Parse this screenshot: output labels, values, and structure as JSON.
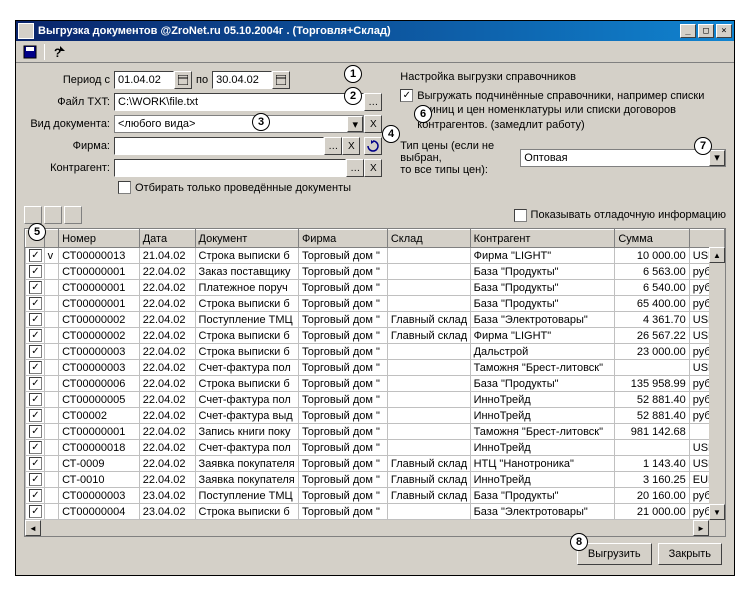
{
  "window": {
    "title": "Выгрузка документов  @ZroNet.ru 05.10.2004г .  (Торговля+Склад)"
  },
  "form": {
    "period_label": "Период с",
    "period_to": "по",
    "period_from_val": "01.04.02",
    "period_to_val": "30.04.02",
    "file_label": "Файл TXT:",
    "file_val": "C:\\WORK\\file.txt",
    "doctype_label": "Вид документа:",
    "doctype_val": "<любого вида>",
    "firm_label": "Фирма:",
    "firm_val": "",
    "contr_label": "Контрагент:",
    "contr_val": "",
    "only_posted": "Отбирать только проведённые документы",
    "right_title": "Настройка выгрузки справочников",
    "subord_chk": "Выгружать подчинённые справочники, например списки единиц и цен номенклатуры или списки договоров контрагентов.  (замедлит работу)",
    "pricetype_label": "Тип цены (если не выбран,\nто все типы цен):",
    "pricetype_val": "Оптовая",
    "debug_label": "Показывать отладочную информацию"
  },
  "callouts": [
    "1",
    "2",
    "3",
    "4",
    "5",
    "6",
    "7",
    "8"
  ],
  "grid": {
    "headers": [
      "",
      "",
      "Номер",
      "Дата",
      "Документ",
      "Фирма",
      "Склад",
      "Контрагент",
      "Сумма",
      ""
    ],
    "rows": [
      {
        "c1": true,
        "c2": "v",
        "num": "СТ00000013",
        "date": "21.04.02",
        "doc": "Строка выписки б",
        "firm": "Торговый дом \"",
        "wh": "",
        "contr": "Фирма \"LIGHT\"",
        "sum": "10 000.00",
        "cur": "USD"
      },
      {
        "c1": true,
        "c2": "",
        "num": "СТ00000001",
        "date": "22.04.02",
        "doc": "Заказ поставщику",
        "firm": "Торговый дом \"",
        "wh": "",
        "contr": "База \"Продукты\"",
        "sum": "6 563.00",
        "cur": "руб."
      },
      {
        "c1": true,
        "c2": "",
        "num": "СТ00000001",
        "date": "22.04.02",
        "doc": "Платежное поруч",
        "firm": "Торговый дом \"",
        "wh": "",
        "contr": "База \"Продукты\"",
        "sum": "6 540.00",
        "cur": "руб."
      },
      {
        "c1": true,
        "c2": "",
        "num": "СТ00000001",
        "date": "22.04.02",
        "doc": "Строка выписки б",
        "firm": "Торговый дом \"",
        "wh": "",
        "contr": "База \"Продукты\"",
        "sum": "65 400.00",
        "cur": "руб."
      },
      {
        "c1": true,
        "c2": "",
        "num": "СТ00000002",
        "date": "22.04.02",
        "doc": "Поступление ТМЦ",
        "firm": "Торговый дом \"",
        "wh": "Главный склад",
        "contr": "База \"Электротовары\"",
        "sum": "4 361.70",
        "cur": "USD"
      },
      {
        "c1": true,
        "c2": "",
        "num": "СТ00000002",
        "date": "22.04.02",
        "doc": "Строка выписки б",
        "firm": "Торговый дом \"",
        "wh": "Главный склад",
        "contr": "Фирма \"LIGHT\"",
        "sum": "26 567.22",
        "cur": "USD"
      },
      {
        "c1": true,
        "c2": "",
        "num": "СТ00000003",
        "date": "22.04.02",
        "doc": "Строка выписки б",
        "firm": "Торговый дом \"",
        "wh": "",
        "contr": "Дальстрой",
        "sum": "23 000.00",
        "cur": "руб."
      },
      {
        "c1": true,
        "c2": "",
        "num": "СТ00000003",
        "date": "22.04.02",
        "doc": "Счет-фактура пол",
        "firm": "Торговый дом \"",
        "wh": "",
        "contr": "Таможня \"Брест-литовск\"",
        "sum": "",
        "cur": "USD"
      },
      {
        "c1": true,
        "c2": "",
        "num": "СТ00000006",
        "date": "22.04.02",
        "doc": "Строка выписки б",
        "firm": "Торговый дом \"",
        "wh": "",
        "contr": "База \"Продукты\"",
        "sum": "135 958.99",
        "cur": "руб."
      },
      {
        "c1": true,
        "c2": "",
        "num": "СТ00000005",
        "date": "22.04.02",
        "doc": "Счет-фактура пол",
        "firm": "Торговый дом \"",
        "wh": "",
        "contr": "ИнноТрейд",
        "sum": "52 881.40",
        "cur": "руб."
      },
      {
        "c1": true,
        "c2": "",
        "num": "СТ00002",
        "date": "22.04.02",
        "doc": "Счет-фактура выд",
        "firm": "Торговый дом \"",
        "wh": "",
        "contr": "ИнноТрейд",
        "sum": "52 881.40",
        "cur": "руб."
      },
      {
        "c1": true,
        "c2": "",
        "num": "СТ00000001",
        "date": "22.04.02",
        "doc": "Запись книги поку",
        "firm": "Торговый дом \"",
        "wh": "",
        "contr": "Таможня \"Брест-литовск\"",
        "sum": "981 142.68",
        "cur": ""
      },
      {
        "c1": true,
        "c2": "",
        "num": "СТ00000018",
        "date": "22.04.02",
        "doc": "Счет-фактура пол",
        "firm": "Торговый дом \"",
        "wh": "",
        "contr": "ИнноТрейд",
        "sum": "",
        "cur": "USD"
      },
      {
        "c1": true,
        "c2": "",
        "num": "СТ-0009",
        "date": "22.04.02",
        "doc": "Заявка покупателя",
        "firm": "Торговый дом \"",
        "wh": "Главный склад",
        "contr": "НТЦ \"Нанотроника\"",
        "sum": "1 143.40",
        "cur": "USD"
      },
      {
        "c1": true,
        "c2": "",
        "num": "СТ-0010",
        "date": "22.04.02",
        "doc": "Заявка покупателя",
        "firm": "Торговый дом \"",
        "wh": "Главный склад",
        "contr": "ИнноТрейд",
        "sum": "3 160.25",
        "cur": "EUR"
      },
      {
        "c1": true,
        "c2": "",
        "num": "СТ00000003",
        "date": "23.04.02",
        "doc": "Поступление ТМЦ",
        "firm": "Торговый дом \"",
        "wh": "Главный склад",
        "contr": "База \"Продукты\"",
        "sum": "20 160.00",
        "cur": "руб."
      },
      {
        "c1": true,
        "c2": "",
        "num": "СТ00000004",
        "date": "23.04.02",
        "doc": "Строка выписки б",
        "firm": "Торговый дом \"",
        "wh": "",
        "contr": "База \"Электротовары\"",
        "sum": "21 000.00",
        "cur": "руб."
      }
    ]
  },
  "footer": {
    "export": "Выгрузить",
    "close": "Закрыть"
  }
}
